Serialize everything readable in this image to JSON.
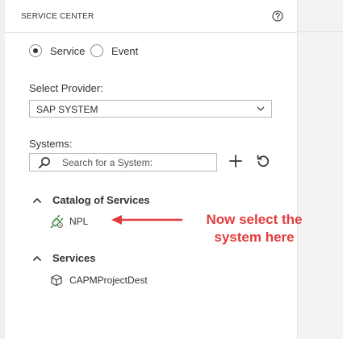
{
  "header": {
    "title": "SERVICE CENTER",
    "help_icon": "help-circle-icon"
  },
  "mode": {
    "options": [
      {
        "label": "Service",
        "checked": true
      },
      {
        "label": "Event",
        "checked": false
      }
    ]
  },
  "provider": {
    "label": "Select Provider:",
    "selected": "SAP SYSTEM"
  },
  "systems": {
    "label": "Systems:",
    "search_placeholder": "Search for a System:",
    "add_icon": "plus-icon",
    "refresh_icon": "refresh-icon"
  },
  "tree": {
    "sections": [
      {
        "title": "Catalog of Services",
        "expanded": true,
        "items": [
          {
            "label": "NPL",
            "icon": "system-connection-icon"
          }
        ]
      },
      {
        "title": "Services",
        "expanded": true,
        "items": [
          {
            "label": "CAPMProjectDest",
            "icon": "cube-icon"
          }
        ]
      }
    ]
  },
  "annotation": {
    "line1": "Now select the",
    "line2": "system here",
    "color": "#e23b3b"
  }
}
